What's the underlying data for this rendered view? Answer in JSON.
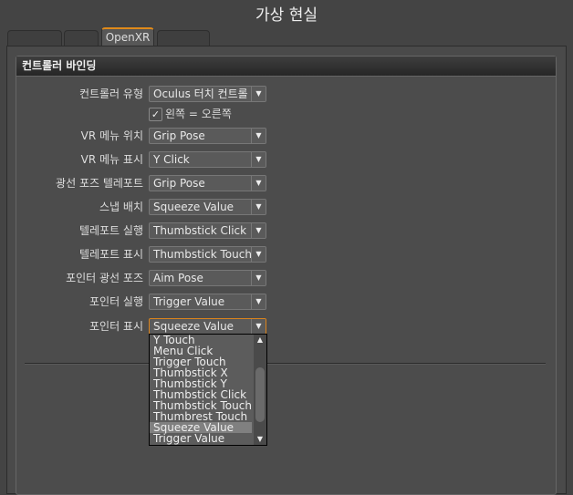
{
  "window": {
    "title": "가상 현실"
  },
  "tabs": [
    {
      "label": ""
    },
    {
      "label": ""
    },
    {
      "label": "OpenXR"
    },
    {
      "label": ""
    }
  ],
  "group": {
    "title": "컨트롤러 바인딩"
  },
  "controller_type": {
    "label": "컨트롤러 유형",
    "value": "Oculus 터치 컨트롤"
  },
  "mirror": {
    "label": "왼쪽 = 오른쪽",
    "checked": true
  },
  "rows": [
    {
      "label": "VR 메뉴 위치",
      "value": "Grip Pose"
    },
    {
      "label": "VR 메뉴 표시",
      "value": "Y Click"
    },
    {
      "label": "광선 포즈 텔레포트",
      "value": "Grip Pose"
    },
    {
      "label": "스냅 배치",
      "value": "Squeeze Value"
    },
    {
      "label": "텔레포트 실행",
      "value": "Thumbstick Click"
    },
    {
      "label": "텔레포트 표시",
      "value": "Thumbstick Touch"
    },
    {
      "label": "포인터 광선 포즈",
      "value": "Aim Pose"
    },
    {
      "label": "포인터 실행",
      "value": "Trigger Value"
    },
    {
      "label": "포인터 표시",
      "value": "Squeeze Value"
    }
  ],
  "dropdown": {
    "options": [
      "Y Touch",
      "Menu Click",
      "Trigger Touch",
      "Thumbstick X",
      "Thumbstick Y",
      "Thumbstick Click",
      "Thumbstick Touch",
      "Thumbrest Touch",
      "Squeeze Value",
      "Trigger Value"
    ],
    "selected": "Squeeze Value"
  }
}
